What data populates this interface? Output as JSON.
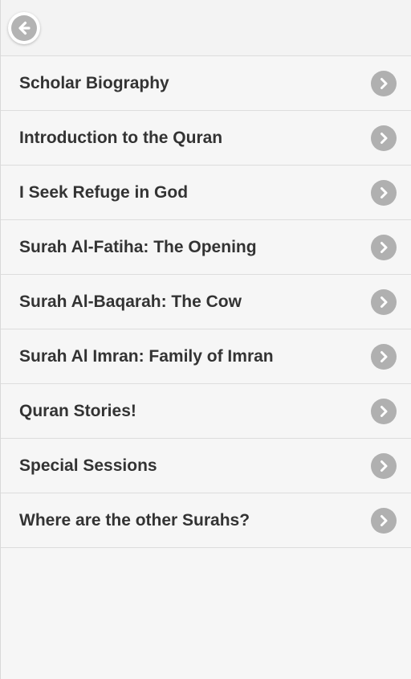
{
  "header": {
    "back_icon": "arrow-left-circle-icon"
  },
  "menu": {
    "items": [
      {
        "label": "Scholar Biography"
      },
      {
        "label": "Introduction to the Quran"
      },
      {
        "label": "I Seek Refuge in God"
      },
      {
        "label": "Surah Al-Fatiha: The Opening"
      },
      {
        "label": "Surah Al-Baqarah: The Cow"
      },
      {
        "label": "Surah Al Imran: Family of Imran"
      },
      {
        "label": "Quran Stories!"
      },
      {
        "label": "Special Sessions"
      },
      {
        "label": "Where are the other Surahs?"
      }
    ],
    "item_icon": "chevron-right-circle-icon"
  },
  "colors": {
    "background": "#f6f6f6",
    "text": "#333333",
    "icon": "#b0b0b0",
    "divider": "#dddddd"
  }
}
